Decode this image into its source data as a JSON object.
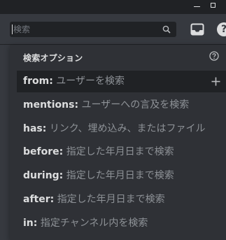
{
  "search": {
    "placeholder": "検索"
  },
  "popout": {
    "header": "検索オプション",
    "options": [
      {
        "key": "from:",
        "hint": "ユーザーを検索"
      },
      {
        "key": "mentions:",
        "hint": "ユーザーへの言及を検索"
      },
      {
        "key": "has:",
        "hint": "リンク、埋め込み、またはファイル"
      },
      {
        "key": "before:",
        "hint": "指定した年月日まで検索"
      },
      {
        "key": "during:",
        "hint": "指定した年月日まで検索"
      },
      {
        "key": "after:",
        "hint": "指定した年月日まで検索"
      },
      {
        "key": "in:",
        "hint": "指定チャンネル内を検索"
      }
    ]
  },
  "colors": {
    "background": "#36393f",
    "popout": "#2f3136",
    "search_bg": "#202225",
    "text": "#dcddde",
    "muted": "#8e9297"
  },
  "icons": [
    "minimize-icon",
    "maximize-icon",
    "search-icon",
    "inbox-icon",
    "help-icon",
    "plus-icon"
  ]
}
